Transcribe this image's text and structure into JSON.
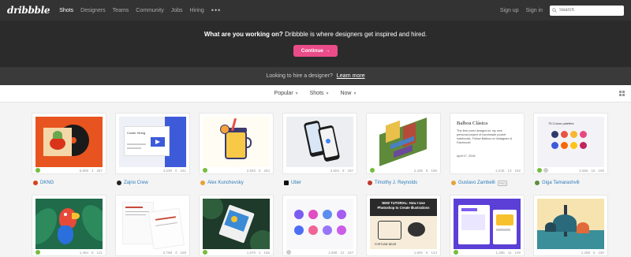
{
  "nav": {
    "logo": "dribbble",
    "links": [
      "Shots",
      "Designers",
      "Teams",
      "Community",
      "Jobs",
      "Hiring"
    ],
    "more": "•••",
    "signup": "Sign up",
    "signin": "Sign in",
    "search_placeholder": "Search"
  },
  "hero": {
    "question": "What are you working on?",
    "tagline": "Dribbble is where designers get inspired and hired.",
    "cta": "Continue →"
  },
  "hire": {
    "text": "Looking to hire a designer?",
    "link": "Learn more"
  },
  "filters": [
    "Popular",
    "Shots",
    "Now"
  ],
  "shots": [
    {
      "views": "5,805",
      "comments": "4",
      "likes": "267",
      "author": "DKNG",
      "avatar": "#d9401c"
    },
    {
      "views": "4,239",
      "comments": "0",
      "likes": "241",
      "author": "Zajno Crew",
      "avatar": "#222"
    },
    {
      "views": "2,583",
      "comments": "5",
      "likes": "254",
      "author": "Alex Kunchevsky",
      "avatar": "#e8a13a"
    },
    {
      "views": "3,604",
      "comments": "8",
      "likes": "187",
      "author": "Uber",
      "avatar": "#111"
    },
    {
      "views": "2,436",
      "comments": "8",
      "likes": "196",
      "author": "Timothy J. Reynolds",
      "avatar": "#c0392b"
    },
    {
      "views": "2,246",
      "comments": "13",
      "likes": "182",
      "author": "Gustavo Zambelli",
      "avatar": "#e3a33b",
      "pro": "PRO"
    },
    {
      "views": "2,665",
      "comments": "15",
      "likes": "190",
      "author": "Giga Tamarashvili",
      "avatar": "#5a8f3c"
    },
    {
      "views": "1,464",
      "comments": "8",
      "likes": "121"
    },
    {
      "views": "2,768",
      "comments": "4",
      "likes": "159"
    },
    {
      "views": "1,670",
      "comments": "4",
      "likes": "166"
    },
    {
      "views": "1,608",
      "comments": "21",
      "likes": "167"
    },
    {
      "views": "1,692",
      "comments": "6",
      "likes": "124"
    },
    {
      "views": "1,266",
      "comments": "11",
      "likes": "149"
    },
    {
      "views": "1,268",
      "comments": "6",
      "likes": "150"
    }
  ],
  "shot_texts": {
    "logistics_title": "Cozier Hiring",
    "balboa_title": "Balboa Clásica",
    "balboa_body": "The first cover designs for my new personal project of handmade pocket notebooks. Follow Balboa on Instagram & Facebook!",
    "balboa_date": "April 17, 2018",
    "palettes_title": "75 Colour palettes",
    "tutorial_title": "NEW TUTORIAL: How I Use Photoshop to Create Illustrations",
    "tutorial_caption": "FORTUNE BEAR"
  }
}
